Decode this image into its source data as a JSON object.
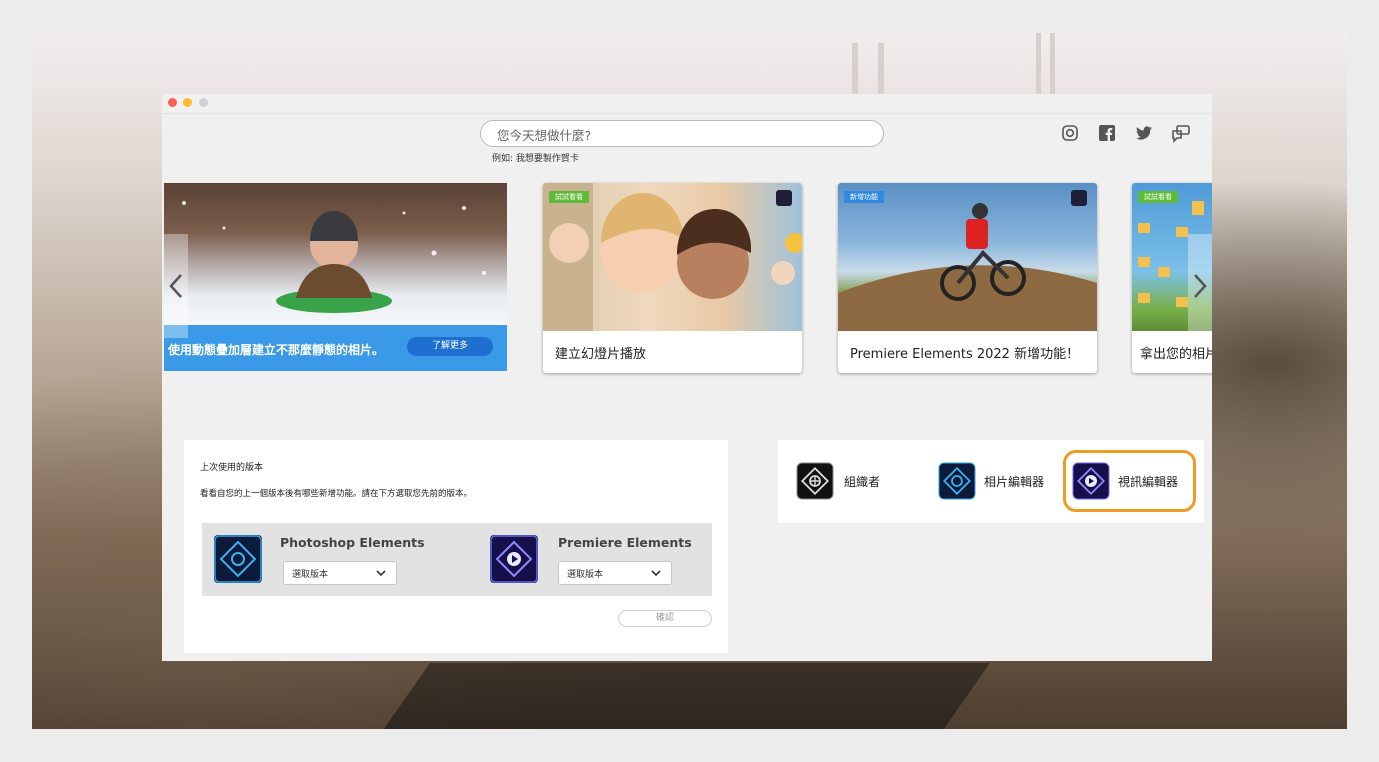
{
  "window": {
    "controls": [
      "close",
      "minimize",
      "maximize"
    ]
  },
  "search": {
    "placeholder": "您今天想做什麼?",
    "hint": "例如: 我想要製作賀卡"
  },
  "social": [
    {
      "name": "instagram-icon"
    },
    {
      "name": "facebook-icon"
    },
    {
      "name": "twitter-icon"
    },
    {
      "name": "feedback-icon"
    }
  ],
  "carousel": {
    "hero": {
      "text": "使用動態疊加層建立不那麼靜態的相片。",
      "button": "了解更多"
    },
    "cards": [
      {
        "tag": "試試看看",
        "caption": "建立幻燈片播放",
        "tag_color": "#5fba3a"
      },
      {
        "tag": "新增功能",
        "caption": "Premiere Elements 2022 新增功能！",
        "tag_color": "#2f8ae0"
      },
      {
        "tag": "試試看看",
        "caption": "拿出您的相片",
        "tag_color": "#5fba3a"
      }
    ],
    "prev_icon": "chevron-left-icon",
    "next_icon": "chevron-right-icon"
  },
  "last_used": {
    "title": "上次使用的版本",
    "description": "看看自您的上一個版本後有哪些新增功能。請在下方選取您先前的版本。",
    "apps": [
      {
        "name": "Photoshop Elements",
        "select": "選取版本"
      },
      {
        "name": "Premiere Elements",
        "select": "選取版本"
      }
    ],
    "confirm": "確認"
  },
  "launchers": [
    {
      "label": "組織者",
      "icon": "organizer-icon"
    },
    {
      "label": "相片編輯器",
      "icon": "photo-editor-icon"
    },
    {
      "label": "視訊編輯器",
      "icon": "video-editor-icon",
      "highlighted": true
    }
  ],
  "colors": {
    "accent_blue": "#3a9ae8",
    "highlight_orange": "#f19b22"
  }
}
